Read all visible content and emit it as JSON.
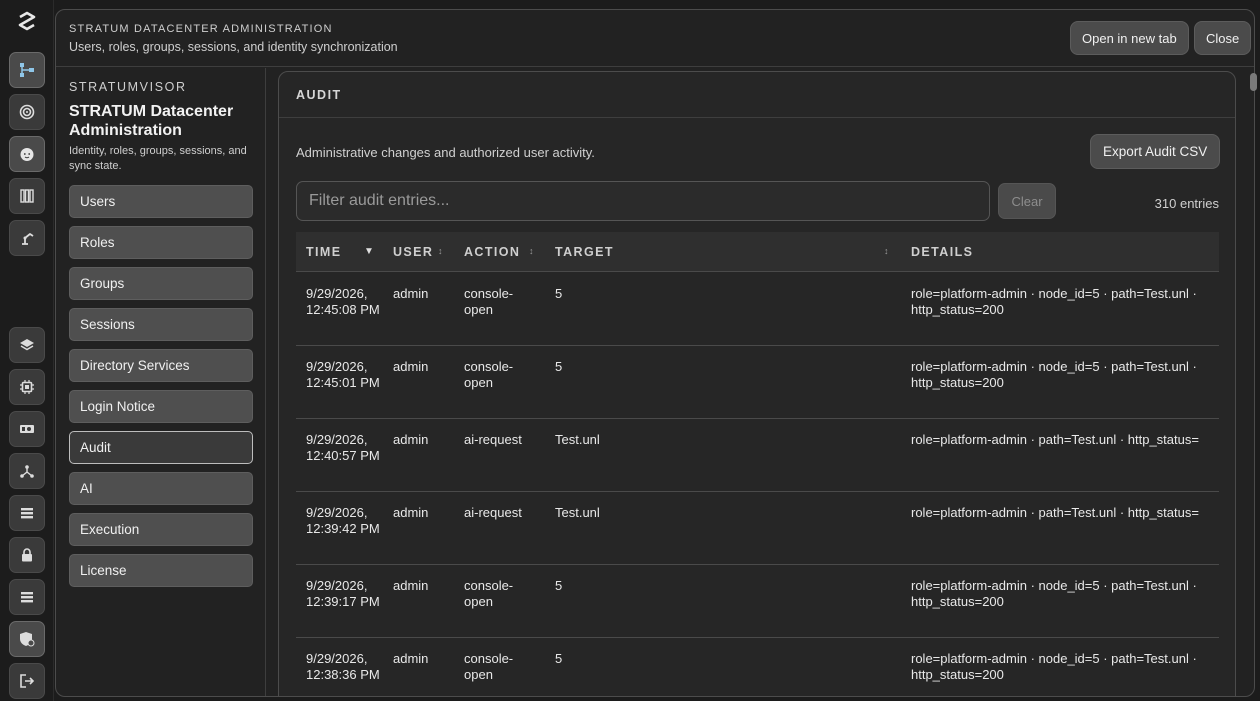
{
  "header": {
    "kicker": "STRATUM DATACENTER ADMINISTRATION",
    "subtitle": "Users, roles, groups, sessions, and identity synchronization",
    "open_new_tab": "Open in new tab",
    "close": "Close"
  },
  "rail": {
    "icons": [
      "stratum-logo-icon",
      "topology-icon",
      "target-icon",
      "baby-face-icon",
      "inventory-rack-icon",
      "robot-arm-icon",
      "layers-icon",
      "chip-icon",
      "gpu-card-icon",
      "network-tree-icon",
      "list-icon",
      "lock-icon",
      "server-list-icon",
      "admin-shield-icon",
      "logout-icon"
    ]
  },
  "sidebar": {
    "brand": "STRATUMVISOR",
    "title": "STRATUM Datacenter Administration",
    "description": "Identity, roles, groups, sessions, and sync state.",
    "items": [
      {
        "label": "Users"
      },
      {
        "label": "Roles"
      },
      {
        "label": "Groups"
      },
      {
        "label": "Sessions"
      },
      {
        "label": "Directory Services"
      },
      {
        "label": "Login Notice"
      },
      {
        "label": "Audit"
      },
      {
        "label": "AI"
      },
      {
        "label": "Execution"
      },
      {
        "label": "License"
      }
    ],
    "active": "Audit"
  },
  "audit": {
    "title": "AUDIT",
    "description": "Administrative changes and authorized user activity.",
    "export_label": "Export Audit CSV",
    "filter_placeholder": "Filter audit entries...",
    "clear_label": "Clear",
    "count": "310 entries",
    "columns": {
      "time": "TIME",
      "user": "USER",
      "action": "ACTION",
      "target": "TARGET",
      "details": "DETAILS"
    },
    "rows": [
      {
        "time": "9/29/2026, 12:45:08 PM",
        "user": "admin",
        "action": "console-open",
        "target": "5",
        "details": "role=platform-admin · node_id=5 · path=Test.unl · http_status=200"
      },
      {
        "time": "9/29/2026, 12:45:01 PM",
        "user": "admin",
        "action": "console-open",
        "target": "5",
        "details": "role=platform-admin · node_id=5 · path=Test.unl · http_status=200"
      },
      {
        "time": "9/29/2026, 12:40:57 PM",
        "user": "admin",
        "action": "ai-request",
        "target": "Test.unl",
        "details": "role=platform-admin · path=Test.unl · http_status="
      },
      {
        "time": "9/29/2026, 12:39:42 PM",
        "user": "admin",
        "action": "ai-request",
        "target": "Test.unl",
        "details": "role=platform-admin · path=Test.unl · http_status="
      },
      {
        "time": "9/29/2026, 12:39:17 PM",
        "user": "admin",
        "action": "console-open",
        "target": "5",
        "details": "role=platform-admin · node_id=5 · path=Test.unl · http_status=200"
      },
      {
        "time": "9/29/2026, 12:38:36 PM",
        "user": "admin",
        "action": "console-open",
        "target": "5",
        "details": "role=platform-admin · node_id=5 · path=Test.unl · http_status=200"
      }
    ]
  }
}
